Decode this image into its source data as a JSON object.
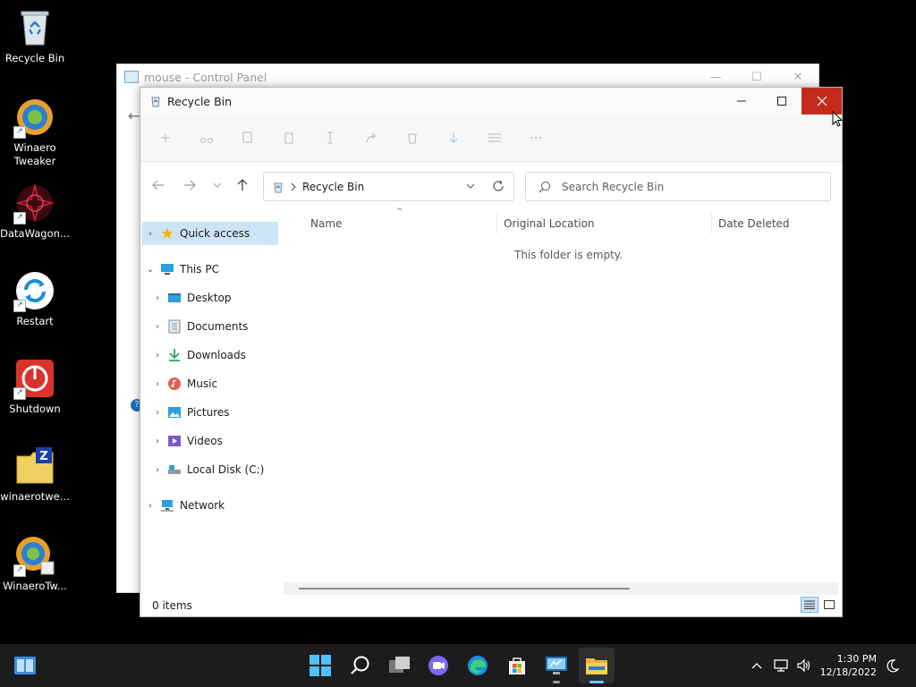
{
  "desktop": {
    "icons": [
      {
        "label": "Recycle Bin",
        "icon": "recycle-bin-icon"
      },
      {
        "label": "Winaero\nTweaker",
        "icon": "winaero-tweaker-icon"
      },
      {
        "label": "DataWagon...",
        "icon": "datawagon-icon"
      },
      {
        "label": "Restart",
        "icon": "restart-icon"
      },
      {
        "label": "Shutdown",
        "icon": "shutdown-icon"
      },
      {
        "label": "winaerotwe...",
        "icon": "zip-folder-icon"
      },
      {
        "label": "WinaeroTw...",
        "icon": "winaero-tweaker-shortcut-icon"
      }
    ]
  },
  "background_window": {
    "title": "mouse - Control Panel"
  },
  "explorer": {
    "title": "Recycle Bin",
    "address": {
      "path": "Recycle Bin"
    },
    "search": {
      "placeholder": "Search Recycle Bin"
    },
    "nav": {
      "quick_access": "Quick access",
      "this_pc": "This PC",
      "items": [
        "Desktop",
        "Documents",
        "Downloads",
        "Music",
        "Pictures",
        "Videos",
        "Local Disk (C:)"
      ],
      "network": "Network"
    },
    "columns": {
      "name": "Name",
      "original_location": "Original Location",
      "date_deleted": "Date Deleted"
    },
    "empty_message": "This folder is empty.",
    "status": {
      "item_count": "0 items"
    }
  },
  "taskbar": {
    "clock_time": "1:30 PM",
    "clock_date": "12/18/2022"
  },
  "colors": {
    "accent": "#0078d4",
    "close_red": "#c42b1c",
    "selection": "#cce4f7",
    "taskbar": "#1c1c1c"
  }
}
